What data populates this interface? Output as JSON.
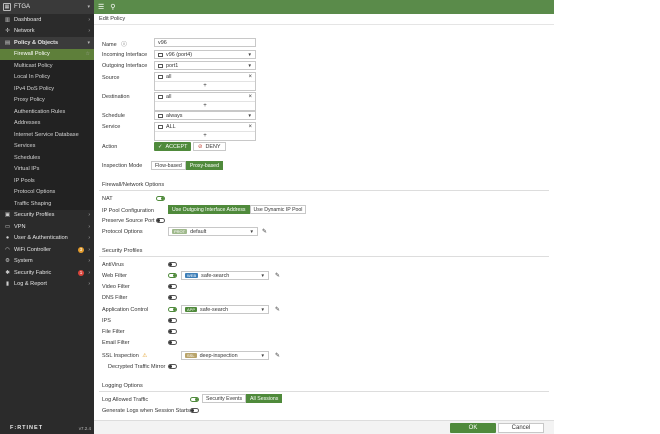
{
  "brand": {
    "name": "FTGA",
    "footer_logo": "F:RTINET",
    "version": "v7.2.4"
  },
  "sidebar": {
    "items": [
      {
        "label": "Dashboard",
        "icon": "dashboard-icon"
      },
      {
        "label": "Network",
        "icon": "network-icon"
      },
      {
        "label": "Policy & Objects",
        "icon": "policy-icon",
        "expanded": true
      }
    ],
    "sub_items": [
      {
        "label": "Firewall Policy",
        "active": true
      },
      {
        "label": "Multicast Policy"
      },
      {
        "label": "Local In Policy"
      },
      {
        "label": "IPv4 DoS Policy"
      },
      {
        "label": "Proxy Policy"
      },
      {
        "label": "Authentication Rules"
      },
      {
        "label": "Addresses"
      },
      {
        "label": "Internet Service Database"
      },
      {
        "label": "Services"
      },
      {
        "label": "Schedules"
      },
      {
        "label": "Virtual IPs"
      },
      {
        "label": "IP Pools"
      },
      {
        "label": "Protocol Options"
      },
      {
        "label": "Traffic Shaping"
      }
    ],
    "bottom_items": [
      {
        "label": "Security Profiles",
        "icon": "lock-icon"
      },
      {
        "label": "VPN",
        "icon": "vpn-icon"
      },
      {
        "label": "User & Authentication",
        "icon": "user-icon"
      },
      {
        "label": "WiFi Controller",
        "icon": "wifi-icon",
        "badge": "3"
      },
      {
        "label": "System",
        "icon": "gear-icon"
      },
      {
        "label": "Security Fabric",
        "icon": "fabric-icon",
        "badge": "1"
      },
      {
        "label": "Log & Report",
        "icon": "chart-icon"
      }
    ]
  },
  "header": {
    "title": "Edit Policy"
  },
  "form": {
    "name_label": "Name",
    "name_value": "v96",
    "incoming_label": "Incoming Interface",
    "incoming_value": "v96 (port4)",
    "outgoing_label": "Outgoing Interface",
    "outgoing_value": "port1",
    "source_label": "Source",
    "source_value": "all",
    "destination_label": "Destination",
    "destination_value": "all",
    "schedule_label": "Schedule",
    "schedule_value": "always",
    "service_label": "Service",
    "service_value": "ALL",
    "action_label": "Action",
    "accept_label": "ACCEPT",
    "deny_label": "DENY",
    "inspection_label": "Inspection Mode",
    "flow_label": "Flow-based",
    "proxy_label": "Proxy-based",
    "plus": "+"
  },
  "firewall_network": {
    "title": "Firewall/Network Options",
    "nat_label": "NAT",
    "ippool_label": "IP Pool Configuration",
    "use_outgoing": "Use Outgoing Interface Address",
    "use_dynamic": "Use Dynamic IP Pool",
    "preserve_label": "Preserve Source Port",
    "protocol_label": "Protocol Options",
    "protocol_tag": "PROT",
    "protocol_value": "default"
  },
  "security_profiles": {
    "title": "Security Profiles",
    "antivirus": "AntiVirus",
    "web_filter": "Web Filter",
    "web_tag": "WEB",
    "web_value": "safe-search",
    "video_filter": "Video Filter",
    "dns_filter": "DNS Filter",
    "app_control": "Application Control",
    "app_tag": "APP",
    "app_value": "safe-search",
    "ips": "IPS",
    "file_filter": "File Filter",
    "email_filter": "Email Filter",
    "ssl_label": "SSL Inspection",
    "ssl_tag": "SSL",
    "ssl_value": "deep-inspection",
    "decrypted_mirror": "Decrypted Traffic Mirror"
  },
  "logging": {
    "title": "Logging Options",
    "log_allowed": "Log Allowed Traffic",
    "security_events": "Security Events",
    "all_sessions": "All Sessions",
    "log_start": "Generate Logs when Session Starts"
  },
  "footer": {
    "ok": "OK",
    "cancel": "Cancel"
  },
  "colors": {
    "accent": "#5a8b4a",
    "button_green": "#4f8a3b",
    "sidebar_bg": "#2b2b2b",
    "active_item": "#5e7f3a"
  }
}
